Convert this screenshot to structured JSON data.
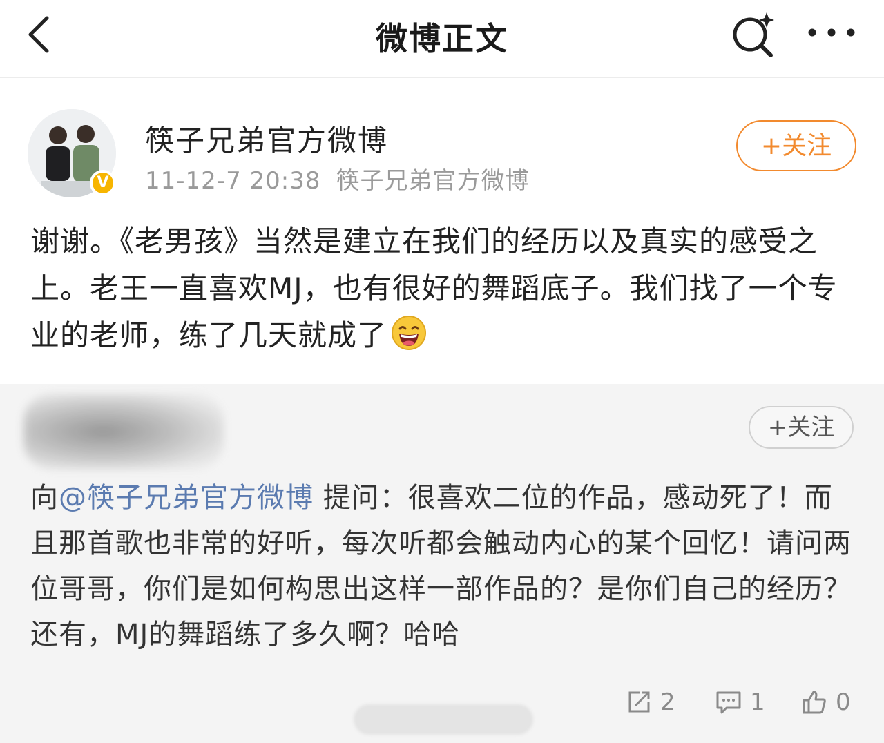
{
  "header": {
    "title": "微博正文",
    "back_icon": "chevron-left-icon",
    "search_icon": "search-sparkle-icon",
    "more_icon": "more-dots-icon"
  },
  "author": {
    "name": "筷子兄弟官方微博",
    "time": "11-12-7 20:38",
    "source": "筷子兄弟官方微博",
    "follow_label": "+关注",
    "verified_badge": "V"
  },
  "post": {
    "text": "谢谢。《老男孩》当然是建立在我们的经历以及真实的感受之上。老王一直喜欢MJ，也有很好的舞蹈底子。我们找了一个专业的老师，练了几天就成了",
    "emoji": "laughing-face-icon"
  },
  "quoted": {
    "follow_label": "+关注",
    "prefix": "向",
    "mention": "@筷子兄弟官方微博",
    "text": " 提问：很喜欢二位的作品，感动死了！而且那首歌也非常的好听，每次听都会触动内心的某个回忆！请问两位哥哥，你们是如何构思出这样一部作品的？是你们自己的经历？还有，MJ的舞蹈练了多久啊？哈哈"
  },
  "actions": {
    "repost_count": "2",
    "comment_count": "1",
    "like_count": "0"
  },
  "colors": {
    "accent": "#f28a2e",
    "mention": "#5b7bb0",
    "verified": "#f7b500",
    "quote_bg": "#f4f4f4"
  }
}
